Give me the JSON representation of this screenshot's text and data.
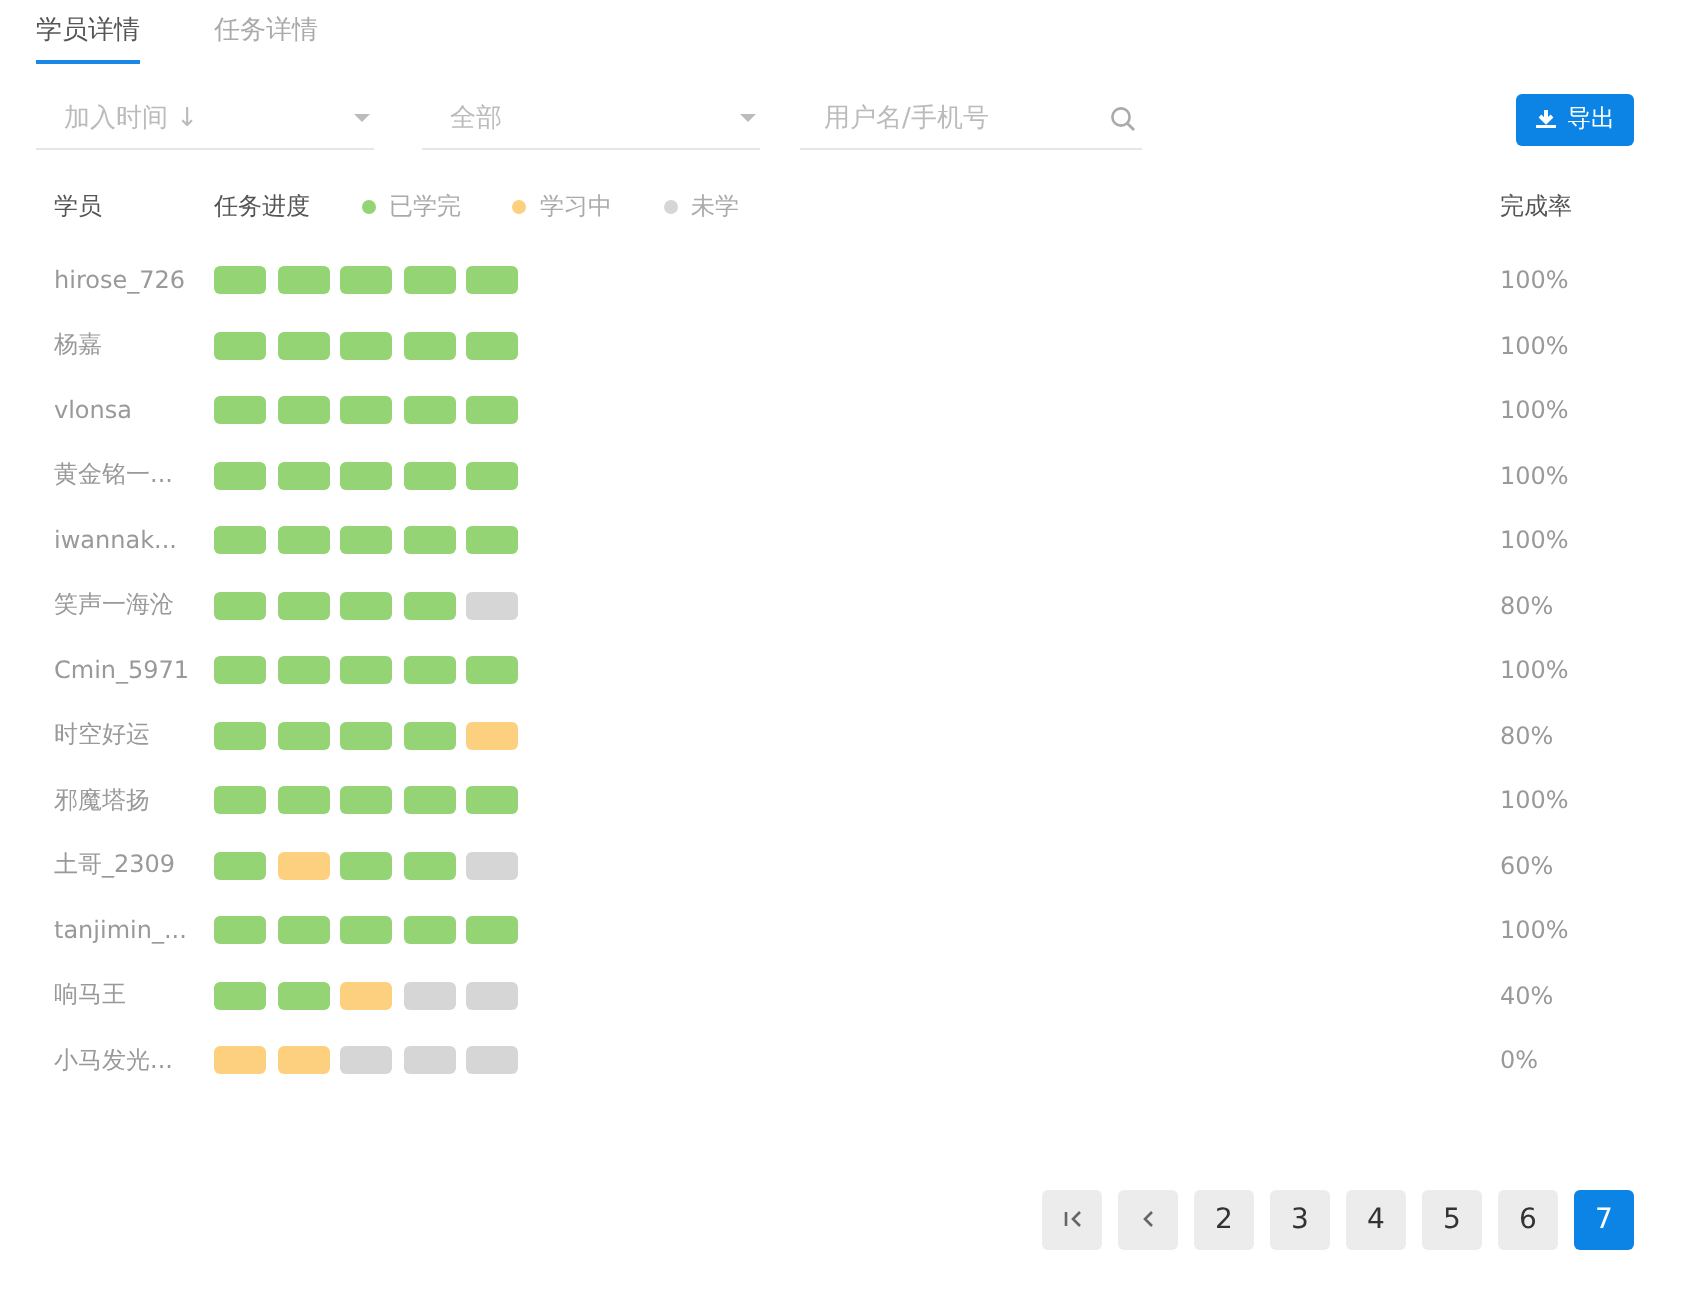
{
  "tabs": [
    {
      "label": "学员详情",
      "selected": true
    },
    {
      "label": "任务详情",
      "selected": false
    }
  ],
  "filters": {
    "sort": {
      "placeholder": "加入时间 ↓"
    },
    "scope": {
      "placeholder": "全部"
    },
    "search": {
      "placeholder": "用户名/手机号"
    }
  },
  "export_button": "导出",
  "table": {
    "columns": [
      "学员",
      "任务进度",
      "完成率"
    ],
    "legend": [
      {
        "label": "已学完",
        "color": "#95d475"
      },
      {
        "label": "学习中",
        "color": "#fdd07f"
      },
      {
        "label": "未学",
        "color": "#d6d6d6"
      }
    ],
    "rows": [
      {
        "name": "hirose_726",
        "tasks": [
          {
            "color": "#95d475"
          },
          {
            "color": "#95d475"
          },
          {
            "color": "#95d475"
          },
          {
            "color": "#95d475"
          },
          {
            "color": "#95d475"
          }
        ],
        "rate": "100%"
      },
      {
        "name": "杨嘉",
        "tasks": [
          {
            "color": "#95d475"
          },
          {
            "color": "#95d475"
          },
          {
            "color": "#95d475"
          },
          {
            "color": "#95d475"
          },
          {
            "color": "#95d475"
          }
        ],
        "rate": "100%"
      },
      {
        "name": "vlonsa",
        "tasks": [
          {
            "color": "#95d475"
          },
          {
            "color": "#95d475"
          },
          {
            "color": "#95d475"
          },
          {
            "color": "#95d475"
          },
          {
            "color": "#95d475"
          }
        ],
        "rate": "100%"
      },
      {
        "name": "黄金铭一...",
        "tasks": [
          {
            "color": "#95d475"
          },
          {
            "color": "#95d475"
          },
          {
            "color": "#95d475"
          },
          {
            "color": "#95d475"
          },
          {
            "color": "#95d475"
          }
        ],
        "rate": "100%"
      },
      {
        "name": "iwannak...",
        "tasks": [
          {
            "color": "#95d475"
          },
          {
            "color": "#95d475"
          },
          {
            "color": "#95d475"
          },
          {
            "color": "#95d475"
          },
          {
            "color": "#95d475"
          }
        ],
        "rate": "100%"
      },
      {
        "name": "笑声一海沧",
        "tasks": [
          {
            "color": "#95d475"
          },
          {
            "color": "#95d475"
          },
          {
            "color": "#95d475"
          },
          {
            "color": "#95d475"
          },
          {
            "color": "#d6d6d6"
          }
        ],
        "rate": "80%"
      },
      {
        "name": "Cmin_5971",
        "tasks": [
          {
            "color": "#95d475"
          },
          {
            "color": "#95d475"
          },
          {
            "color": "#95d475"
          },
          {
            "color": "#95d475"
          },
          {
            "color": "#95d475"
          }
        ],
        "rate": "100%"
      },
      {
        "name": "时空好运",
        "tasks": [
          {
            "color": "#95d475"
          },
          {
            "color": "#95d475"
          },
          {
            "color": "#95d475"
          },
          {
            "color": "#95d475"
          },
          {
            "color": "#fdd07f"
          }
        ],
        "rate": "80%"
      },
      {
        "name": "邪魔塔扬",
        "tasks": [
          {
            "color": "#95d475"
          },
          {
            "color": "#95d475"
          },
          {
            "color": "#95d475"
          },
          {
            "color": "#95d475"
          },
          {
            "color": "#95d475"
          }
        ],
        "rate": "100%"
      },
      {
        "name": "土哥_2309",
        "tasks": [
          {
            "color": "#95d475"
          },
          {
            "color": "#fdd07f"
          },
          {
            "color": "#95d475"
          },
          {
            "color": "#95d475"
          },
          {
            "color": "#d6d6d6"
          }
        ],
        "rate": "60%"
      },
      {
        "name": "tanjimin_...",
        "tasks": [
          {
            "color": "#95d475"
          },
          {
            "color": "#95d475"
          },
          {
            "color": "#95d475"
          },
          {
            "color": "#95d475"
          },
          {
            "color": "#95d475"
          }
        ],
        "rate": "100%"
      },
      {
        "name": "响马王",
        "tasks": [
          {
            "color": "#95d475"
          },
          {
            "color": "#95d475"
          },
          {
            "color": "#fdd07f"
          },
          {
            "color": "#d6d6d6"
          },
          {
            "color": "#d6d6d6"
          }
        ],
        "rate": "40%"
      },
      {
        "name": "小马发光...",
        "tasks": [
          {
            "color": "#fdd07f"
          },
          {
            "color": "#fdd07f"
          },
          {
            "color": "#d6d6d6"
          },
          {
            "color": "#d6d6d6"
          },
          {
            "color": "#d6d6d6"
          }
        ],
        "rate": "0%"
      }
    ]
  },
  "pagination": {
    "pages": [
      {
        "label": "2",
        "selected": false
      },
      {
        "label": "3",
        "selected": false
      },
      {
        "label": "4",
        "selected": false
      },
      {
        "label": "5",
        "selected": false
      },
      {
        "label": "6",
        "selected": false
      },
      {
        "label": "7",
        "selected": true
      }
    ]
  }
}
